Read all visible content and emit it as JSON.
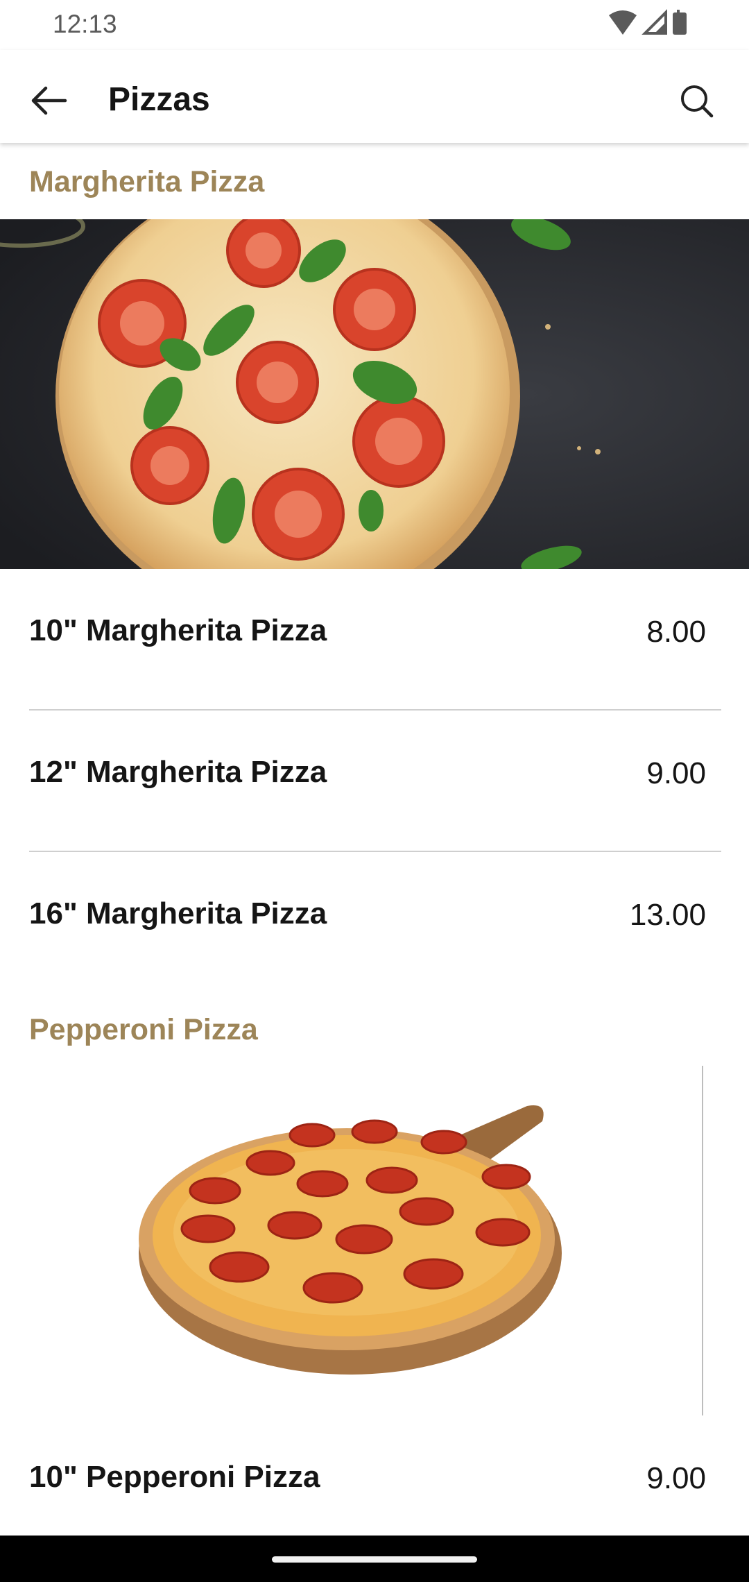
{
  "status_bar": {
    "time": "12:13",
    "icons": [
      "wifi-icon",
      "cell-signal-icon",
      "battery-icon"
    ]
  },
  "app_bar": {
    "title": "Pizzas",
    "back_icon": "arrow-left-icon",
    "search_icon": "search-icon"
  },
  "colors": {
    "accent": "#9d8558",
    "text": "#151515",
    "divider": "#cfcfcf"
  },
  "sections": [
    {
      "title": "Margherita Pizza",
      "image": "margherita-pizza-photo",
      "items": [
        {
          "name": "10\" Margherita Pizza",
          "price": "8.00"
        },
        {
          "name": "12\" Margherita Pizza",
          "price": "9.00"
        },
        {
          "name": "16\" Margherita Pizza",
          "price": "13.00"
        }
      ]
    },
    {
      "title": "Pepperoni Pizza",
      "image": "pepperoni-pizza-photo",
      "items": [
        {
          "name": "10\" Pepperoni Pizza",
          "price": "9.00"
        }
      ]
    }
  ]
}
